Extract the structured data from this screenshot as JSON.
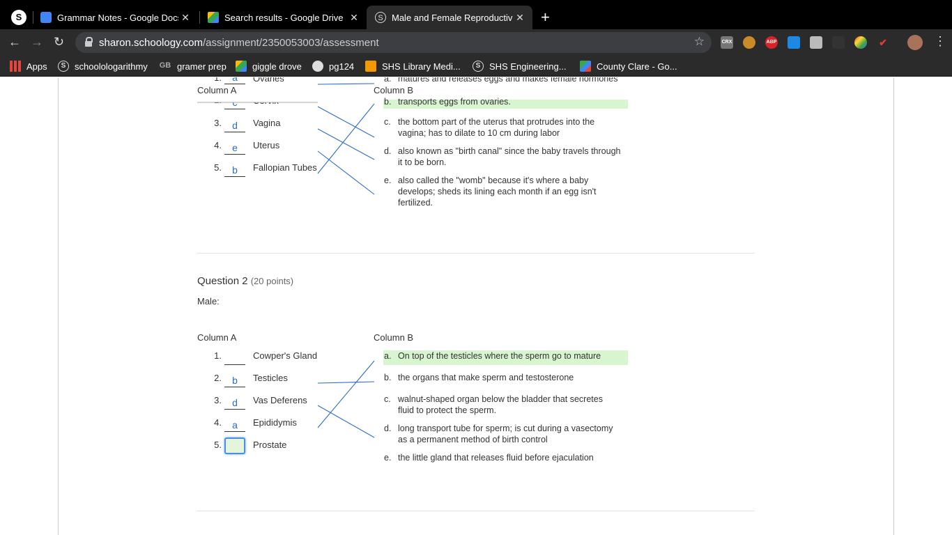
{
  "browser": {
    "app_icon": "S",
    "tabs": [
      {
        "title": "Grammar Notes - Google Docs",
        "close": "✕"
      },
      {
        "title": "Search results - Google Drive",
        "close": "✕"
      },
      {
        "title": "Male and Female Reproductive",
        "close": "✕"
      }
    ],
    "new_tab": "+",
    "back": "←",
    "forward": "→",
    "reload": "↻",
    "url_host": "sharon.schoology.com",
    "url_path": "/assignment/2350053003/assessment",
    "star": "☆",
    "extensions": [
      "CRX",
      "ABP"
    ],
    "menu": "⋮",
    "bookmarks": [
      {
        "label": "Apps",
        "icon": "apps-grid-icon"
      },
      {
        "label": "schoolologarithmy",
        "icon": "schoology-icon"
      },
      {
        "label": "gramer prep",
        "icon": "gb-icon"
      },
      {
        "label": "giggle drove",
        "icon": "google-drive-icon"
      },
      {
        "label": "pg124",
        "icon": "globe-icon"
      },
      {
        "label": "SHS Library Medi...",
        "icon": "library-icon"
      },
      {
        "label": "SHS Engineering...",
        "icon": "schoology-icon"
      },
      {
        "label": "County Clare - Go...",
        "icon": "google-maps-icon"
      }
    ]
  },
  "question1": {
    "column_a": "Column A",
    "column_b": "Column B",
    "items": [
      {
        "num": "1.",
        "answer": "a",
        "label": "Ovaries"
      },
      {
        "num": "2.",
        "answer": "c",
        "label": "Cervix"
      },
      {
        "num": "3.",
        "answer": "d",
        "label": "Vagina"
      },
      {
        "num": "4.",
        "answer": "e",
        "label": "Uterus"
      },
      {
        "num": "5.",
        "answer": "b",
        "label": "Fallopian Tubes"
      }
    ],
    "defs": [
      {
        "letter": "a.",
        "text": "matures and releases eggs and makes female hormones"
      },
      {
        "letter": "b.",
        "text": "transports eggs from ovaries."
      },
      {
        "letter": "c.",
        "text": "the bottom part of the uterus that protrudes into the\nvagina; has to dilate to 10 cm during labor"
      },
      {
        "letter": "d.",
        "text": "also known as \"birth canal\" since the baby travels through\nit to be born."
      },
      {
        "letter": "e.",
        "text": "also called the \"womb\" because it's where a baby\ndevelops; sheds its lining each month if an egg isn't\nfertilized."
      }
    ]
  },
  "question2": {
    "title": "Question 2",
    "points": "(20 points)",
    "prompt": "Male:",
    "column_a": "Column A",
    "column_b": "Column B",
    "items": [
      {
        "num": "1.",
        "answer": "",
        "label": "Cowper's Gland"
      },
      {
        "num": "2.",
        "answer": "b",
        "label": "Testicles"
      },
      {
        "num": "3.",
        "answer": "d",
        "label": "Vas Deferens"
      },
      {
        "num": "4.",
        "answer": "a",
        "label": "Epididymis"
      },
      {
        "num": "5.",
        "answer": "",
        "label": "Prostate"
      }
    ],
    "defs": [
      {
        "letter": "a.",
        "text": "On top of the testicles where the sperm go to mature"
      },
      {
        "letter": "b.",
        "text": "the organs that make sperm and testosterone"
      },
      {
        "letter": "c.",
        "text": "walnut-shaped organ below the bladder that secretes\nfluid to protect the sperm."
      },
      {
        "letter": "d.",
        "text": "long transport tube for sperm; is cut during a vasectomy\nas a permanent method of birth control"
      },
      {
        "letter": "e.",
        "text": "the little gland that releases fluid before ejaculation"
      }
    ]
  },
  "colors": {
    "highlight": "#d7f5cf",
    "answer_text": "#2a6cc4",
    "match_line": "#2a6cc4"
  }
}
